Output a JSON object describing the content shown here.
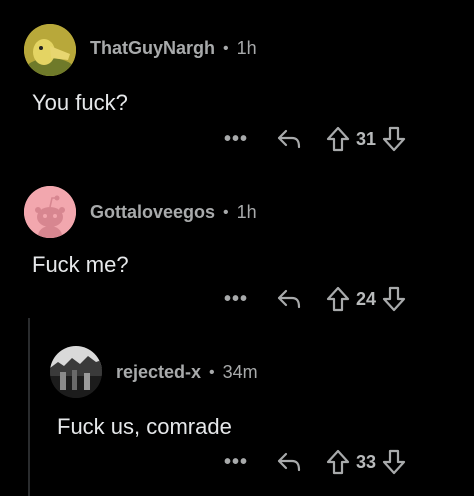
{
  "comments": [
    {
      "username": "ThatGuyNargh",
      "separator": "•",
      "age": "1h",
      "text": "You fuck?",
      "more_label": "•••",
      "score": "31",
      "avatar": "duck-avatar"
    },
    {
      "username": "Gottaloveegos",
      "separator": "•",
      "age": "1h",
      "text": "Fuck me?",
      "more_label": "•••",
      "score": "24",
      "avatar": "snoo-avatar"
    },
    {
      "username": "rejected-x",
      "separator": "•",
      "age": "34m",
      "text": "Fuck us, comrade",
      "more_label": "•••",
      "score": "33",
      "avatar": "photo-avatar"
    }
  ],
  "colors": {
    "background": "#000000",
    "meta_text": "#a8aaab",
    "body_text": "#e6e8ea",
    "snoo_pink": "#f2a7ae"
  }
}
